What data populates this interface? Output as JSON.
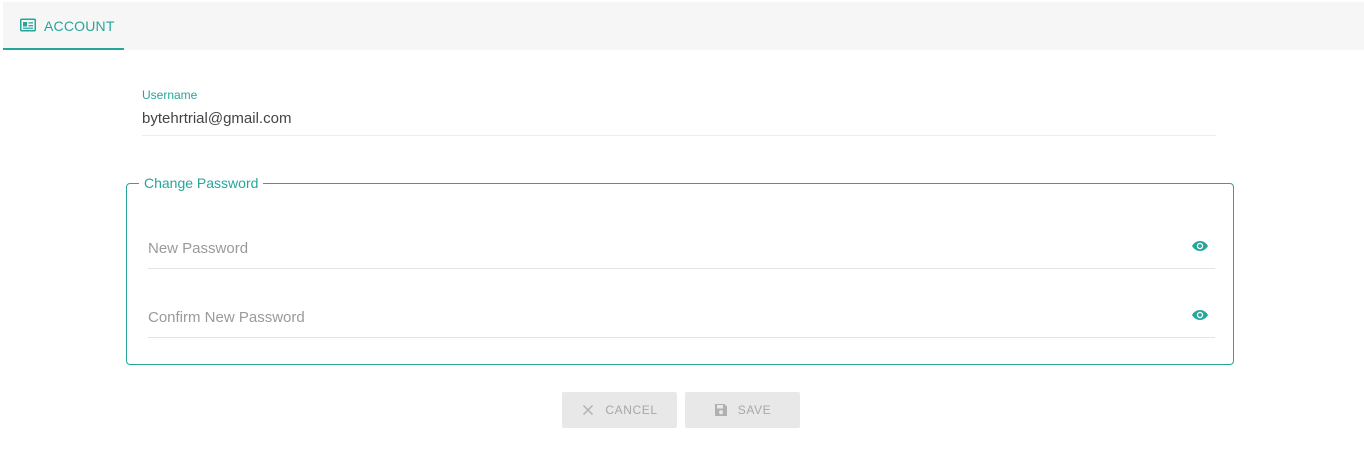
{
  "tabs": [
    {
      "label": "ACCOUNT",
      "icon": "id-card-icon",
      "active": true
    }
  ],
  "account": {
    "username_label": "Username",
    "username_value": "bytehrtrial@gmail.com"
  },
  "change_password": {
    "legend": "Change Password",
    "new_password_placeholder": "New Password",
    "confirm_password_placeholder": "Confirm New Password",
    "toggle_icon": "eye-icon"
  },
  "actions": {
    "cancel_label": "CANCEL",
    "cancel_icon": "close-icon",
    "save_label": "SAVE",
    "save_icon": "save-icon"
  },
  "colors": {
    "accent": "#26a69a",
    "disabled_bg": "#e8e8e8",
    "disabled_text": "#a8a8a8"
  }
}
